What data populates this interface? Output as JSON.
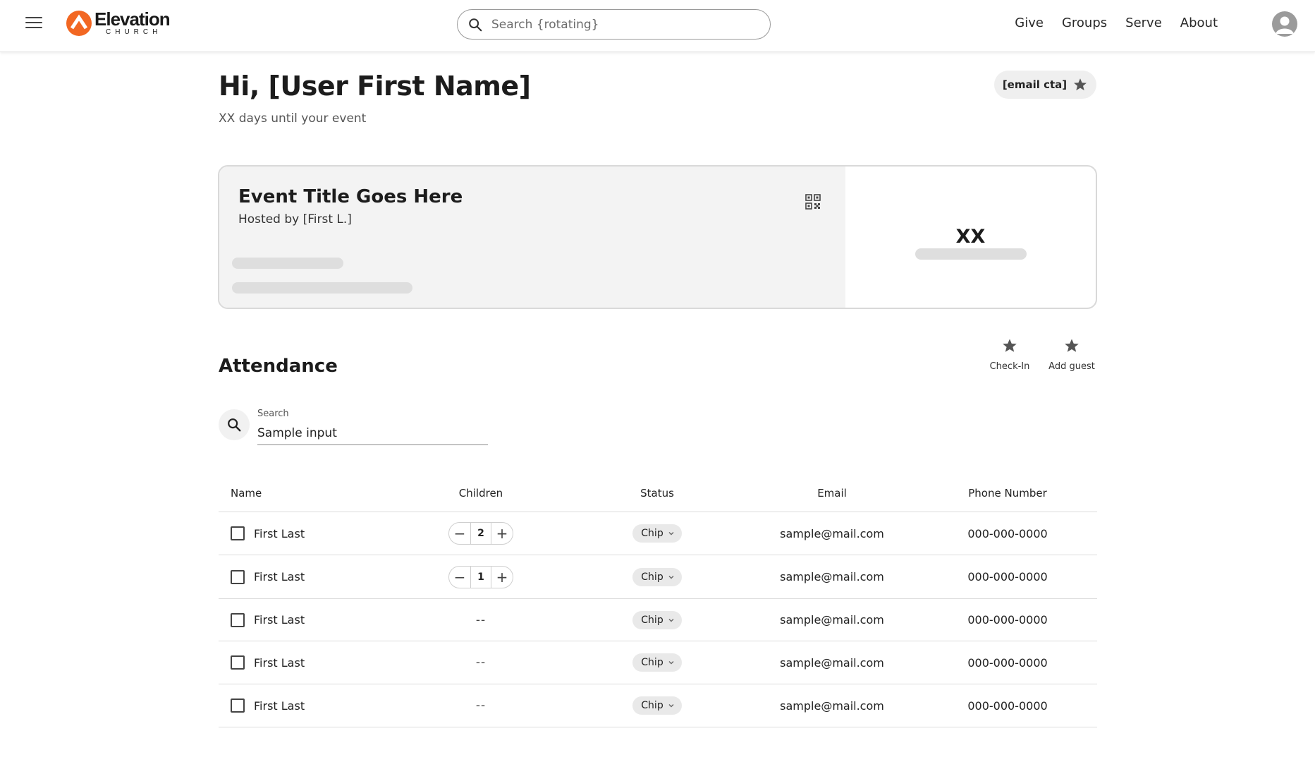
{
  "header": {
    "logo_word": "Elevation",
    "logo_sub": "CHURCH",
    "search_placeholder": "Search {rotating}",
    "nav": [
      "Give",
      "Groups",
      "Serve",
      "About"
    ]
  },
  "greeting": {
    "title": "Hi, [User First Name]",
    "subtitle": "XX days until your event",
    "email_cta": "[email cta]"
  },
  "event": {
    "title": "Event Title Goes Here",
    "host": "Hosted by [First L.]",
    "count": "XX"
  },
  "attendance": {
    "title": "Attendance",
    "actions": [
      "Check-In",
      "Add guest"
    ],
    "search_label": "Search",
    "search_value": "Sample input",
    "columns": [
      "Name",
      "Children",
      "Status",
      "Email",
      "Phone Number"
    ],
    "rows": [
      {
        "name": "First Last",
        "children": "2",
        "status": "Chip",
        "email": "sample@mail.com",
        "phone": "000-000-0000"
      },
      {
        "name": "First Last",
        "children": "1",
        "status": "Chip",
        "email": "sample@mail.com",
        "phone": "000-000-0000"
      },
      {
        "name": "First Last",
        "children": "--",
        "status": "Chip",
        "email": "sample@mail.com",
        "phone": "000-000-0000"
      },
      {
        "name": "First Last",
        "children": "--",
        "status": "Chip",
        "email": "sample@mail.com",
        "phone": "000-000-0000"
      },
      {
        "name": "First Last",
        "children": "--",
        "status": "Chip",
        "email": "sample@mail.com",
        "phone": "000-000-0000"
      }
    ]
  },
  "colors": {
    "brand_orange": "#F26722",
    "text": "#1f1f1f",
    "card_gray": "#f3f3f3",
    "chip_gray": "#e9e9e9"
  },
  "icons": [
    "menu-icon",
    "logo-mark-icon",
    "search-icon",
    "avatar-icon",
    "star-icon",
    "qr-code-icon",
    "minus-icon",
    "plus-icon",
    "chevron-down-icon"
  ]
}
